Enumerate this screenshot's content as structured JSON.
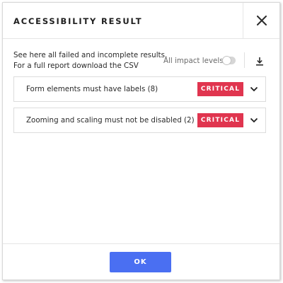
{
  "dialog": {
    "title": "ACCESSIBILITY RESULT",
    "close_icon": "close-icon"
  },
  "intro": {
    "line1": "See here all failed and incomplete results.",
    "line2": "For a full report download the CSV"
  },
  "filters": {
    "impact_label": "All impact levels",
    "impact_toggle_on": false,
    "download_icon": "download-icon"
  },
  "results": [
    {
      "label": "Form elements must have labels (8)",
      "impact": "CRITICAL",
      "expand_icon": "chevron-down-icon"
    },
    {
      "label": "Zooming and scaling must not be disabled (2)",
      "impact": "CRITICAL",
      "expand_icon": "chevron-down-icon"
    }
  ],
  "footer": {
    "ok_label": "OK"
  },
  "colors": {
    "critical": "#e0354f",
    "primary": "#4a6ff2"
  }
}
